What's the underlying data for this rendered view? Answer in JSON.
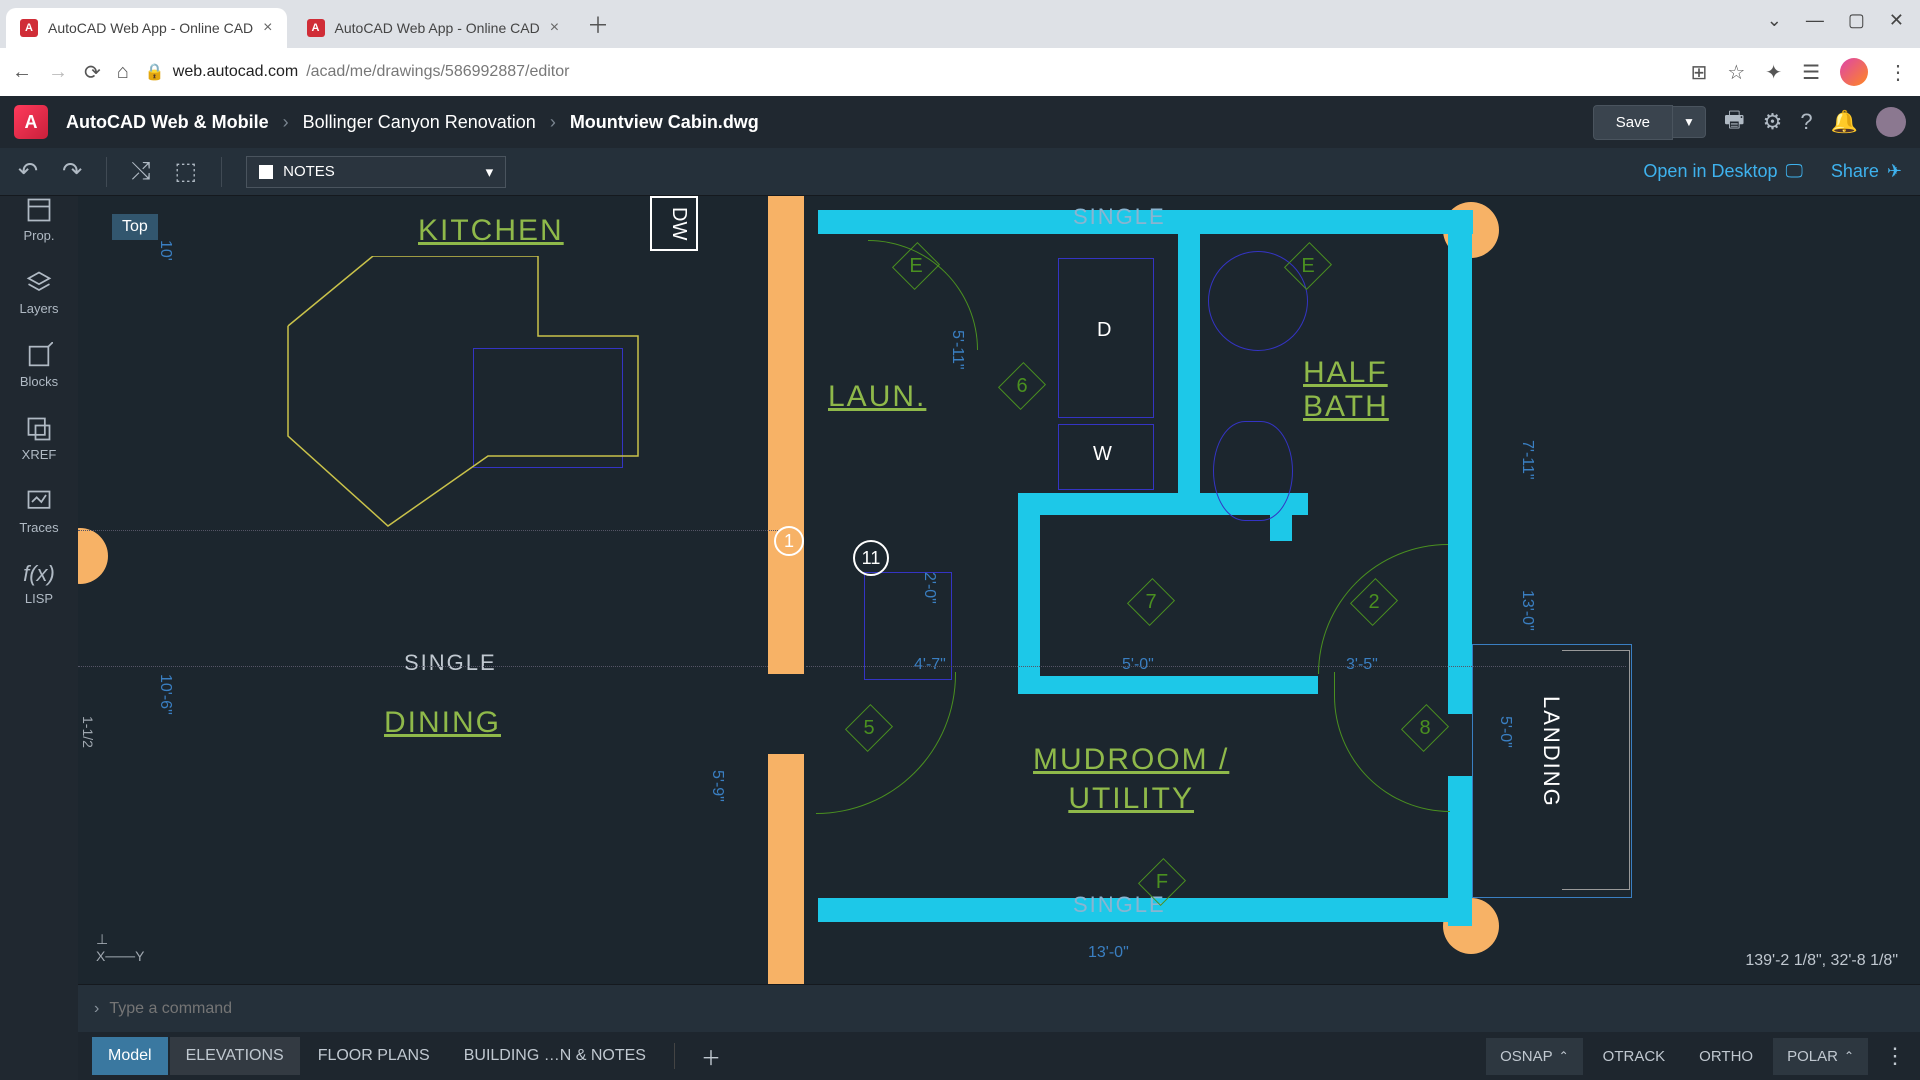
{
  "browser": {
    "tabs": [
      {
        "title": "AutoCAD Web App - Online CAD"
      },
      {
        "title": "AutoCAD Web App - Online CAD"
      }
    ],
    "url_domain": "web.autocad.com",
    "url_path": "/acad/me/drawings/586992887/editor"
  },
  "header": {
    "app_name": "AutoCAD Web & Mobile",
    "crumb1": "Bollinger Canyon Renovation",
    "crumb2": "Mountview Cabin.dwg",
    "save": "Save"
  },
  "toolbar": {
    "layer_name": "NOTES",
    "open_desktop": "Open in Desktop",
    "share": "Share"
  },
  "sidebar": {
    "prop": "Prop.",
    "layers": "Layers",
    "blocks": "Blocks",
    "xref": "XREF",
    "traces": "Traces",
    "lisp": "LISP"
  },
  "canvas": {
    "view": "Top",
    "coords": "139'-2 1/8\", 32'-8 1/8\"",
    "scale": "1-1/2"
  },
  "drawing": {
    "rooms": {
      "kitchen": "KITCHEN",
      "laun": "LAUN.",
      "halfbath": "HALF BATH",
      "dining": "DINING",
      "mudroom": "MUDROOM / UTILITY",
      "landing": "LANDING"
    },
    "appliances": {
      "dw": "DW",
      "d": "D",
      "w": "W"
    },
    "notes": {
      "single1": "SINGLE",
      "single2": "SINGLE",
      "single3": "SINGLE"
    },
    "tags": {
      "e1": "E",
      "e2": "E",
      "f": "F",
      "n1": "1",
      "n11": "11",
      "n5": "5",
      "n6": "6",
      "n7": "7",
      "n8": "8",
      "n2": "2"
    },
    "dims": {
      "d10": "10'",
      "d106": "10'-6\"",
      "d47": "4'-7\"",
      "d50": "5'-0\"",
      "d35": "3'-5\"",
      "d130": "13'-0\"",
      "d130b": "13'-0\"",
      "d711": "7'-11\"",
      "d511": "5'-11\"",
      "d20": "2'-0\"",
      "d59": "5'-9\"",
      "d501": "5'-0\""
    }
  },
  "cmd": {
    "placeholder": "Type a command"
  },
  "layouts": [
    "Model",
    "ELEVATIONS",
    "FLOOR PLANS",
    "BUILDING …N & NOTES"
  ],
  "status": {
    "osnap": "OSNAP",
    "otrack": "OTRACK",
    "ortho": "ORTHO",
    "polar": "POLAR"
  }
}
